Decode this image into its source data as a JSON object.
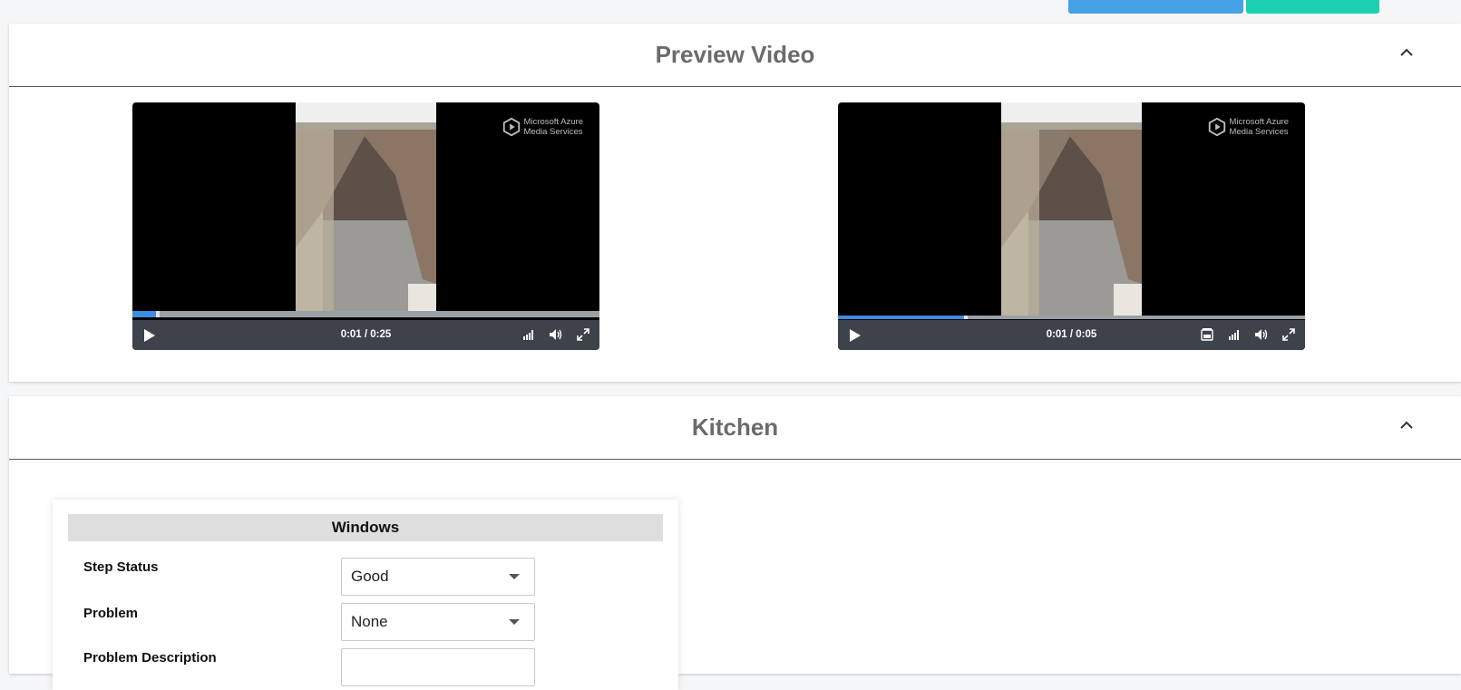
{
  "top_buttons": {
    "primary": {
      "label": "",
      "color": "#45a2e6"
    },
    "secondary": {
      "label": "",
      "color": "#1ccfb2"
    }
  },
  "preview_section": {
    "title": "Preview Video",
    "collapse_icon": "chevron-up-icon",
    "videos": [
      {
        "watermark_line1": "Microsoft Azure",
        "watermark_line2": "Media Services",
        "time": "0:01 / 0:25",
        "progress": 0.05,
        "icons": [
          "quality-icon",
          "volume-icon",
          "fullscreen-icon"
        ]
      },
      {
        "watermark_line1": "Microsoft Azure",
        "watermark_line2": "Media Services",
        "time": "0:01 / 0:05",
        "progress": 0.27,
        "icons": [
          "captions-icon",
          "quality-icon",
          "volume-icon",
          "fullscreen-icon"
        ]
      }
    ]
  },
  "kitchen_section": {
    "title": "Kitchen",
    "collapse_icon": "chevron-up-icon",
    "card": {
      "heading": "Windows",
      "fields": [
        {
          "label": "Step Status",
          "value": "Good"
        },
        {
          "label": "Problem",
          "value": "None"
        },
        {
          "label": "Problem Description",
          "value": ""
        }
      ]
    }
  }
}
